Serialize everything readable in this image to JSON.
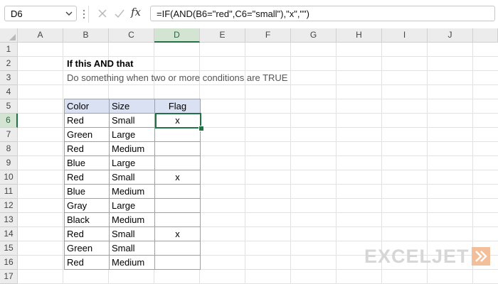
{
  "formula_bar": {
    "name_box": "D6",
    "fx_label": "fx",
    "formula": "=IF(AND(B6=\"red\",C6=\"small\"),\"x\",\"\")"
  },
  "columns": [
    "A",
    "B",
    "C",
    "D",
    "E",
    "F",
    "G",
    "H",
    "I",
    "J"
  ],
  "rows": [
    "1",
    "2",
    "3",
    "4",
    "5",
    "6",
    "7",
    "8",
    "9",
    "10",
    "11",
    "12",
    "13",
    "14",
    "15",
    "16",
    "17"
  ],
  "sheet": {
    "title": "If this AND that",
    "subtitle": "Do something when two or more conditions are TRUE",
    "table": {
      "headers": [
        "Color",
        "Size",
        "Flag"
      ],
      "rows": [
        [
          "Red",
          "Small",
          "x"
        ],
        [
          "Green",
          "Large",
          ""
        ],
        [
          "Red",
          "Medium",
          ""
        ],
        [
          "Blue",
          "Large",
          ""
        ],
        [
          "Red",
          "Small",
          "x"
        ],
        [
          "Blue",
          "Medium",
          ""
        ],
        [
          "Gray",
          "Large",
          ""
        ],
        [
          "Black",
          "Medium",
          ""
        ],
        [
          "Red",
          "Small",
          "x"
        ],
        [
          "Green",
          "Small",
          ""
        ],
        [
          "Red",
          "Medium",
          ""
        ]
      ]
    }
  },
  "selection": {
    "cell": "D6",
    "column": "D",
    "row": "6"
  },
  "logo": {
    "text": "EXCELJET"
  },
  "colors": {
    "accent": "#217346",
    "header_fill": "#d9e1f2",
    "logo": "#d6d6d6"
  },
  "icons": {
    "name_box_dropdown": "chevron-down-icon",
    "cancel": "x-icon",
    "enter": "check-icon",
    "function": "fx-icon"
  }
}
